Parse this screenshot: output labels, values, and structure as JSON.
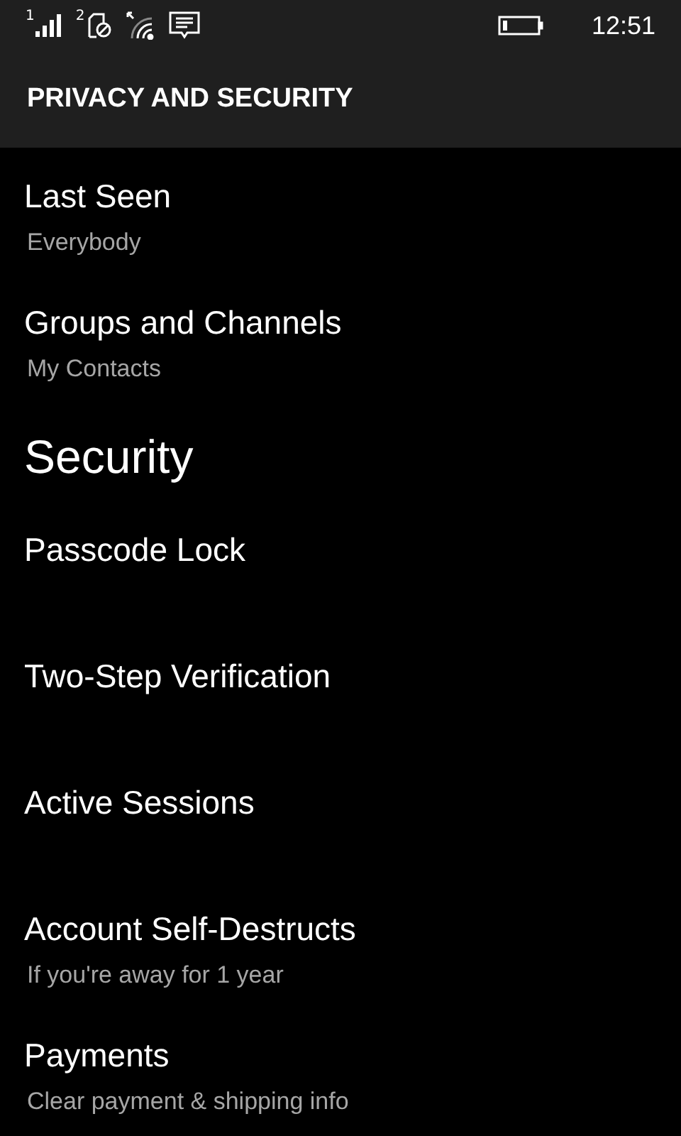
{
  "status_bar": {
    "sim_1": "1",
    "sim_2": "2",
    "time": "12:51"
  },
  "header": {
    "title": "PRIVACY AND SECURITY"
  },
  "sections": [
    {
      "items": [
        {
          "title": "Last Seen",
          "subtitle": "Everybody"
        },
        {
          "title": "Groups and Channels",
          "subtitle": "My Contacts"
        }
      ]
    },
    {
      "heading": "Security",
      "items": [
        {
          "title": "Passcode Lock"
        },
        {
          "title": "Two-Step Verification"
        },
        {
          "title": "Active Sessions"
        },
        {
          "title": "Account Self-Destructs",
          "subtitle": "If you're away for 1 year"
        },
        {
          "title": "Payments",
          "subtitle": "Clear payment & shipping info"
        }
      ]
    }
  ]
}
